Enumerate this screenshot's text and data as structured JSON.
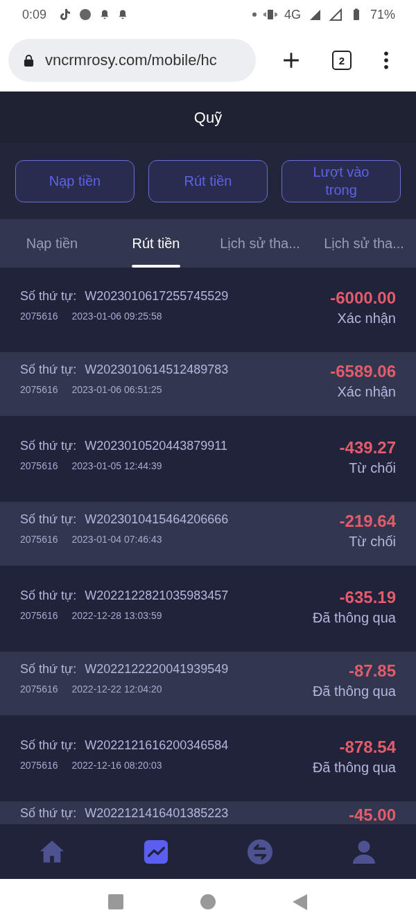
{
  "status_bar": {
    "time": "0:09",
    "network": "4G",
    "battery": "71%"
  },
  "browser": {
    "url": "vncrmrosy.com/mobile/hc",
    "tab_count": "2"
  },
  "header": {
    "title": "Quỹ"
  },
  "actions": [
    "Nạp tiền",
    "Rút tiền",
    "Lượt vào trong"
  ],
  "tabs": [
    {
      "label": "Nạp tiền",
      "selected": false
    },
    {
      "label": "Rút tiền",
      "selected": true
    },
    {
      "label": "Lịch sử tha...",
      "selected": false
    },
    {
      "label": "Lịch sử tha...",
      "selected": false
    }
  ],
  "records": [
    {
      "order_label": "Số thứ tự:",
      "order_no": "W2023010617255745529",
      "user_id": "2075616",
      "time": "2023-01-06 09:25:58",
      "amount": "-6000.00",
      "status": "Xác nhận"
    },
    {
      "order_label": "Số thứ tự:",
      "order_no": "W2023010614512489783",
      "user_id": "2075616",
      "time": "2023-01-06 06:51:25",
      "amount": "-6589.06",
      "status": "Xác nhận"
    },
    {
      "order_label": "Số thứ tự:",
      "order_no": "W2023010520443879911",
      "user_id": "2075616",
      "time": "2023-01-05 12:44:39",
      "amount": "-439.27",
      "status": "Từ chối"
    },
    {
      "order_label": "Số thứ tự:",
      "order_no": "W2023010415464206666",
      "user_id": "2075616",
      "time": "2023-01-04 07:46:43",
      "amount": "-219.64",
      "status": "Từ chối"
    },
    {
      "order_label": "Số thứ tự:",
      "order_no": "W2022122821035983457",
      "user_id": "2075616",
      "time": "2022-12-28 13:03:59",
      "amount": "-635.19",
      "status": "Đã thông qua"
    },
    {
      "order_label": "Số thứ tự:",
      "order_no": "W2022122220041939549",
      "user_id": "2075616",
      "time": "2022-12-22 12:04:20",
      "amount": "-87.85",
      "status": "Đã thông qua"
    },
    {
      "order_label": "Số thứ tự:",
      "order_no": "W2022121616200346584",
      "user_id": "2075616",
      "time": "2022-12-16 08:20:03",
      "amount": "-878.54",
      "status": "Đã thông qua"
    },
    {
      "order_label": "Số thứ tự:",
      "order_no": "W2022121416401385223",
      "amount": "-45.00"
    }
  ],
  "bottom_nav": [
    {
      "kind": "home",
      "selected": false
    },
    {
      "kind": "chart",
      "selected": true
    },
    {
      "kind": "exchange",
      "selected": false
    },
    {
      "kind": "user",
      "selected": false
    }
  ]
}
